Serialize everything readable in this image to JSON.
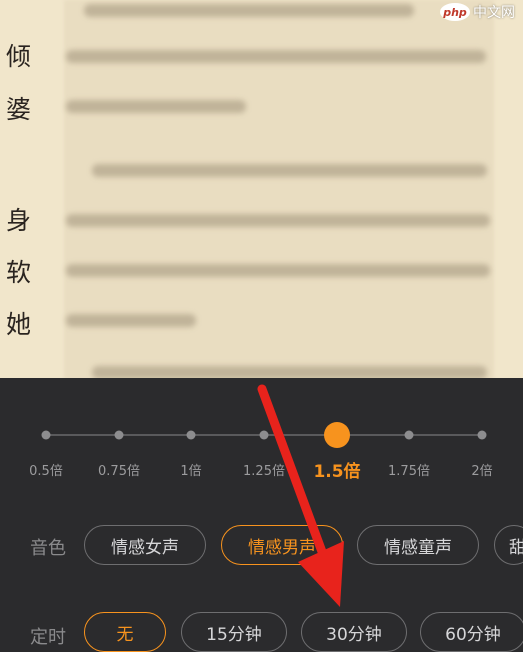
{
  "watermark": {
    "logo": "php",
    "text": "中文网"
  },
  "reader": {
    "visible_chars": [
      "倾",
      "婆",
      "身",
      "软",
      "她"
    ]
  },
  "speed": {
    "options": [
      "0.5倍",
      "0.75倍",
      "1倍",
      "1.25倍",
      "1.5倍",
      "1.75倍",
      "2倍"
    ],
    "selected": "1.5倍"
  },
  "voice": {
    "label": "音色",
    "options": [
      "情感女声",
      "情感男声",
      "情感童声",
      "甜"
    ],
    "selected": "情感男声"
  },
  "timer": {
    "label": "定时",
    "options": [
      "无",
      "15分钟",
      "30分钟",
      "60分钟"
    ],
    "selected": "无"
  },
  "colors": {
    "accent": "#f7931e",
    "annotation_arrow": "#e8231c",
    "panel_bg": "#2b2b2d",
    "page_bg": "#f1e6cb"
  }
}
